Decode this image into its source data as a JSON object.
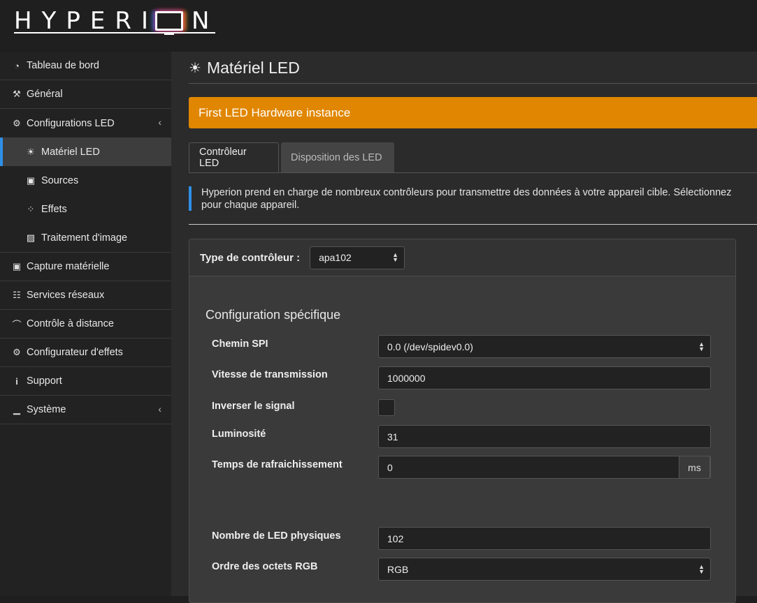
{
  "app": {
    "logo_text": "HYPERI",
    "logo_end": "N"
  },
  "sidebar": {
    "items": [
      {
        "label": "Tableau de bord",
        "icon": "dashboard-icon",
        "glyph": "◔"
      },
      {
        "label": "Général",
        "icon": "wrench-icon",
        "glyph": "⚒"
      },
      {
        "label": "Configurations LED",
        "icon": "gear-icon",
        "glyph": "⚙",
        "chevron": "‹"
      },
      {
        "label": "Matériel LED",
        "icon": "lightbulb-icon",
        "glyph": "☀"
      },
      {
        "label": "Sources",
        "icon": "camera-icon",
        "glyph": "▣"
      },
      {
        "label": "Effets",
        "icon": "spinner-icon",
        "glyph": "⁘"
      },
      {
        "label": "Traitement d'image",
        "icon": "image-icon",
        "glyph": "▨"
      },
      {
        "label": "Capture matérielle",
        "icon": "camera-icon",
        "glyph": "▣"
      },
      {
        "label": "Services réseaux",
        "icon": "sitemap-icon",
        "glyph": "☷"
      },
      {
        "label": "Contrôle à distance",
        "icon": "wifi-icon",
        "glyph": "⌒"
      },
      {
        "label": "Configurateur d'effets",
        "icon": "gears-icon",
        "glyph": "⚙"
      },
      {
        "label": "Support",
        "icon": "info-icon",
        "glyph": "i"
      },
      {
        "label": "Système",
        "icon": "chart-icon",
        "glyph": "▁",
        "chevron": "‹"
      }
    ]
  },
  "main": {
    "title": "Matériel LED",
    "banner": "First LED Hardware instance",
    "tabs": [
      {
        "label": "Contrôleur LED",
        "active": true
      },
      {
        "label": "Disposition des LED",
        "active": false
      }
    ],
    "info_line1": "Hyperion prend en charge de nombreux contrôleurs pour transmettre des données à votre appareil cible. Sélectionnez",
    "info_line2": "pour chaque appareil.",
    "controller_type_label": "Type de contrôleur :",
    "controller_type_value": "apa102",
    "section_title": "Configuration spécifique",
    "fields": {
      "spi_path": {
        "label": "Chemin SPI",
        "value": "0.0 (/dev/spidev0.0)"
      },
      "baudrate": {
        "label": "Vitesse de transmission",
        "value": "1000000"
      },
      "invert": {
        "label": "Inverser le signal",
        "checked": false
      },
      "brightness": {
        "label": "Luminosité",
        "value": "31"
      },
      "refresh": {
        "label": "Temps de rafraichissement",
        "value": "0",
        "unit": "ms"
      },
      "led_count": {
        "label": "Nombre de LED physiques",
        "value": "102"
      },
      "rgb_order": {
        "label": "Ordre des octets RGB",
        "value": "RGB"
      }
    }
  },
  "colors": {
    "accent": "#2e8fe6",
    "banner": "#e08600"
  }
}
